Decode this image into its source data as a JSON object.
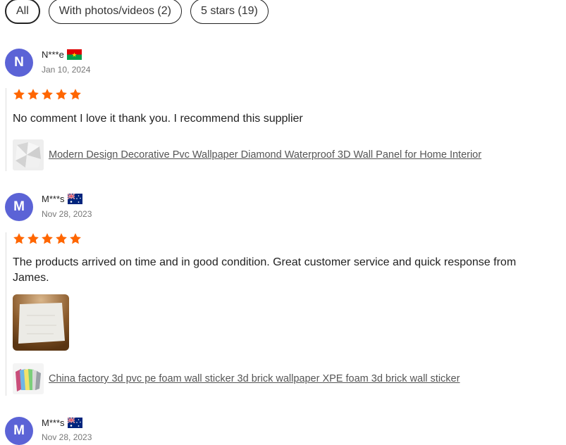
{
  "filters": [
    {
      "label": "All",
      "active": true
    },
    {
      "label": "With photos/videos (2)",
      "active": false
    },
    {
      "label": "5 stars (19)",
      "active": false
    }
  ],
  "reviews": [
    {
      "initial": "N",
      "name": "N***e",
      "flag": "burkina-faso-flag-icon",
      "date": "Jan 10, 2024",
      "rating": 5,
      "comment": "No comment I love it thank you. I recommend this supplier",
      "product": "Modern Design Decorative Pvc Wallpaper Diamond Waterproof 3D Wall Panel for Home Interior"
    },
    {
      "initial": "M",
      "name": "M***s",
      "flag": "australia-flag-icon",
      "date": "Nov 28, 2023",
      "rating": 5,
      "comment": "The products arrived on time and in good condition. Great customer service and quick response from James.",
      "product": "China factory 3d pvc pe foam wall sticker 3d brick wallpaper XPE foam 3d brick wall sticker"
    },
    {
      "initial": "M",
      "name": "M***s",
      "flag": "australia-flag-icon",
      "date": "Nov 28, 2023"
    }
  ],
  "colors": {
    "star": "#ff6600",
    "avatar": "#5b63d6"
  }
}
